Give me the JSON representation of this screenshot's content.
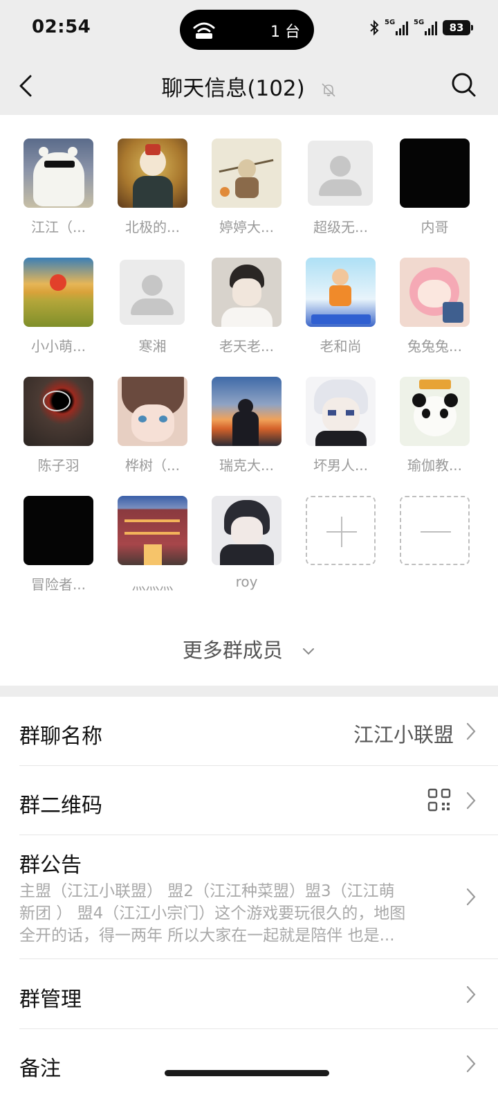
{
  "status_bar": {
    "time": "02:54",
    "island_count": "1 台",
    "signal_labels": [
      "5G",
      "5G"
    ],
    "battery": "83"
  },
  "nav": {
    "title": "聊天信息(102)",
    "back_icon": "chevron-left-icon",
    "mute_icon": "bell-off-icon",
    "search_icon": "search-icon"
  },
  "members": [
    {
      "name": "江江（...",
      "avatar": "polar-bear"
    },
    {
      "name": "北极的...",
      "avatar": "anime-fox-mask"
    },
    {
      "name": "婷婷大...",
      "avatar": "ink-sketch"
    },
    {
      "name": "超级无...",
      "avatar": "default-person"
    },
    {
      "name": "内哥",
      "avatar": "black"
    },
    {
      "name": "小小萌...",
      "avatar": "sunset-field"
    },
    {
      "name": "寒湘",
      "avatar": "default-person"
    },
    {
      "name": "老天老...",
      "avatar": "sketch-boy"
    },
    {
      "name": "老和尚",
      "avatar": "promo-boy"
    },
    {
      "name": "兔兔兔...",
      "avatar": "pink-anime"
    },
    {
      "name": "陈子羽",
      "avatar": "black-hole"
    },
    {
      "name": "桦树（...",
      "avatar": "anime-girl"
    },
    {
      "name": "瑞克大...",
      "avatar": "dusk-sky"
    },
    {
      "name": "坏男人...",
      "avatar": "white-hair-anime"
    },
    {
      "name": "瑜伽教...",
      "avatar": "panda"
    },
    {
      "name": "冒险者...",
      "avatar": "black"
    },
    {
      "name": "灬灬灬",
      "avatar": "hotel"
    },
    {
      "name": "roy",
      "avatar": "dark-anime"
    }
  ],
  "more_members": "更多群成员",
  "settings": {
    "group_name": {
      "label": "群聊名称",
      "value": "江江小联盟"
    },
    "qr_code": {
      "label": "群二维码",
      "icon": "qr-code-icon"
    },
    "notice": {
      "label": "群公告",
      "lines": [
        "主盟（江江小联盟） 盟2（江江种菜盟）盟3（江江萌",
        "新团 ） 盟4（江江小宗门）这个游戏要玩很久的，地图",
        "全开的话，得一两年 所以大家在一起就是陪伴  也是..."
      ]
    },
    "manage": {
      "label": "群管理"
    },
    "remark": {
      "label": "备注"
    }
  },
  "colors": {
    "header_bg": "#ededed",
    "text_primary": "#111111",
    "text_secondary": "#9a9a9a"
  }
}
